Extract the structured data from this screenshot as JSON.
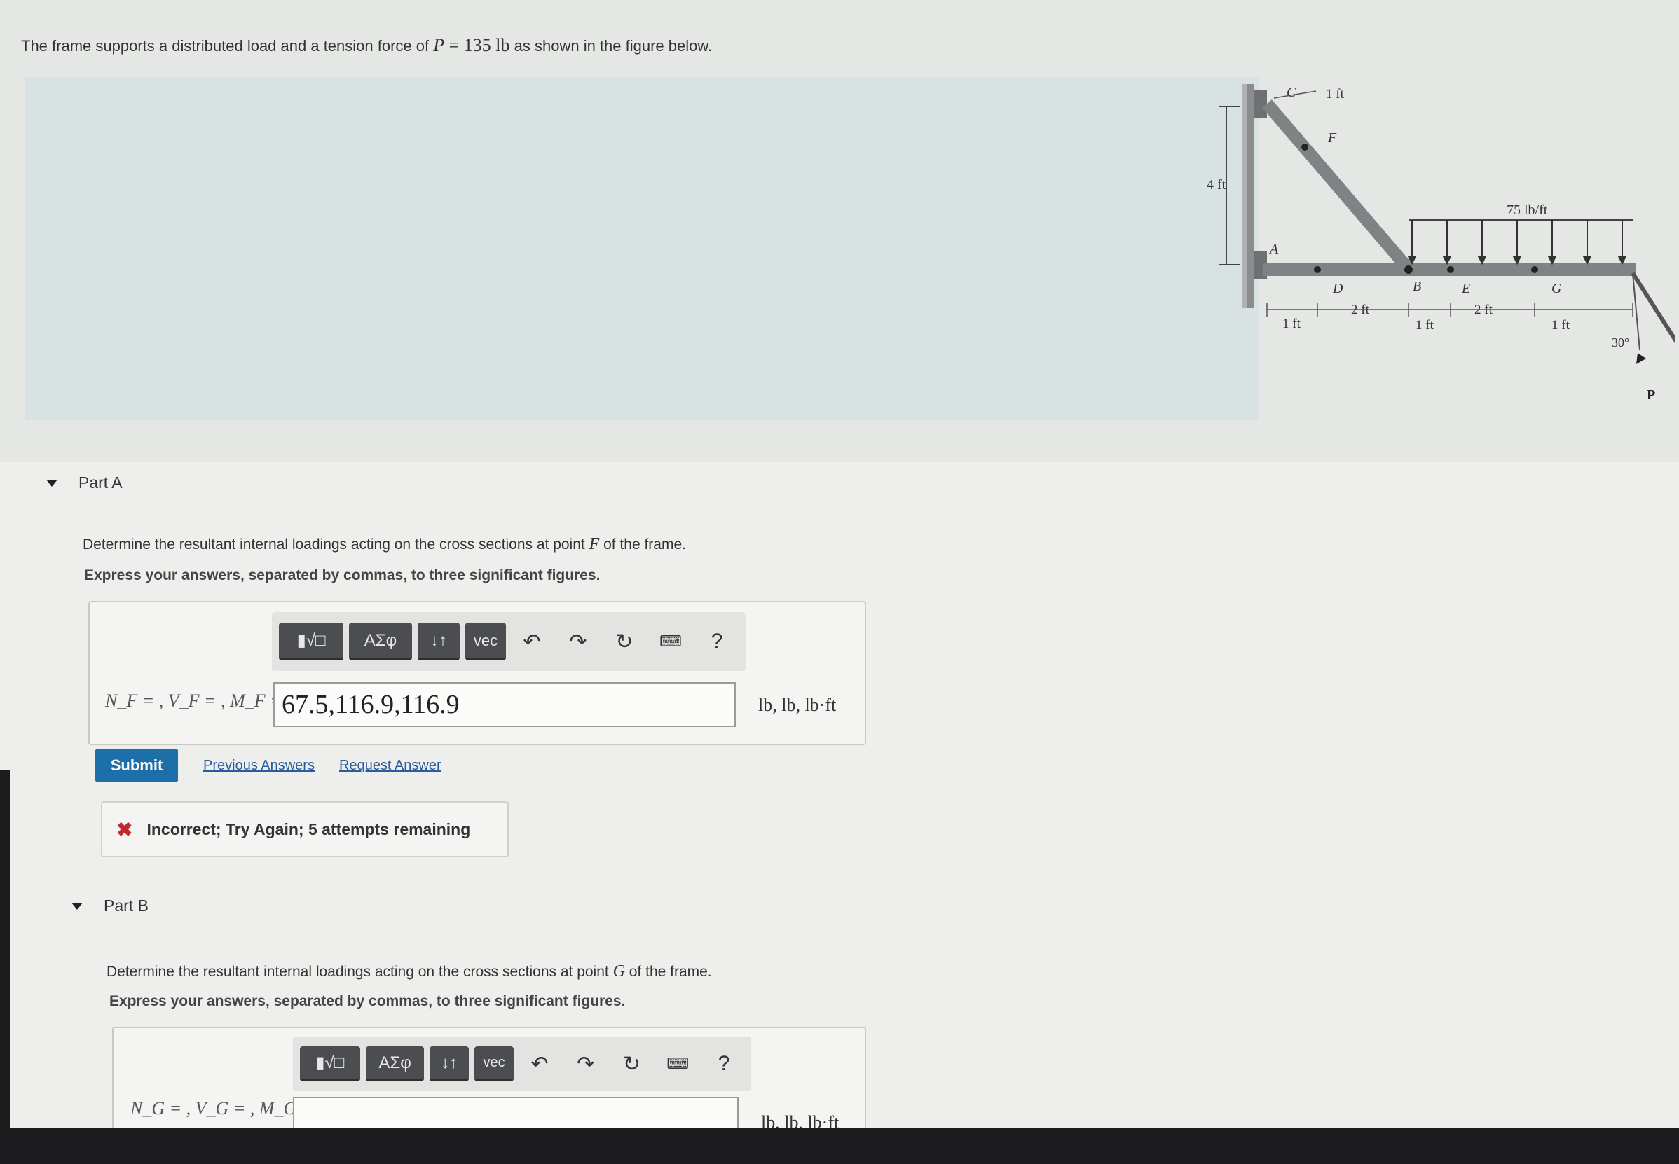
{
  "problem": {
    "intro_before": "The frame supports a distributed load and a tension force of ",
    "intro_var": "P",
    "intro_eq": " = 135 ",
    "intro_unit": "lb",
    "intro_after": " as shown in the figure below."
  },
  "figure": {
    "labels": {
      "c": "C",
      "f": "F",
      "a": "A",
      "d": "D",
      "b": "B",
      "e": "E",
      "g": "G",
      "p": "P",
      "dim_1ft_top": "1 ft",
      "dim_4ft": "4 ft",
      "load": "75 lb/ft",
      "dim_1ft_a": "1 ft",
      "dim_2ft_d": "2 ft",
      "dim_1ft_b": "1 ft",
      "dim_2ft_e": "2 ft",
      "dim_1ft_g": "1 ft",
      "angle": "30°"
    }
  },
  "part_a": {
    "title": "Part A",
    "question_before": "Determine the resultant internal loadings acting on the cross sections at point ",
    "question_point": "F",
    "question_after": " of the frame.",
    "instruction": "Express your answers, separated by commas, to three significant figures.",
    "label": "N_F = , V_F = , M_F =",
    "value": "67.5,116.9,116.9",
    "units": "lb, lb, lb·ft",
    "submit": "Submit",
    "previous_answers": "Previous Answers",
    "request_answer": "Request Answer",
    "feedback": "Incorrect; Try Again; 5 attempts remaining"
  },
  "part_b": {
    "title": "Part B",
    "question_before": "Determine the resultant internal loadings acting on the cross sections at point ",
    "question_point": "G",
    "question_after": " of the frame.",
    "instruction": "Express your answers, separated by commas, to three significant figures.",
    "label": "N_G = , V_G = , M_G =",
    "value": "",
    "units": "lb, lb, lb·ft"
  },
  "toolbar": {
    "templates": "▮√□",
    "greek": "ΑΣφ",
    "arrows": "↓↑",
    "vec": "vec",
    "undo_icon": "undo-icon",
    "redo_icon": "redo-icon",
    "reset_icon": "reset-icon",
    "keyboard_icon": "keyboard-icon",
    "help": "?"
  },
  "colors": {
    "submit": "#1c6fa8",
    "link": "#2a5c9c",
    "error": "#c0282d",
    "toolbar_button": "#4b4d50"
  }
}
